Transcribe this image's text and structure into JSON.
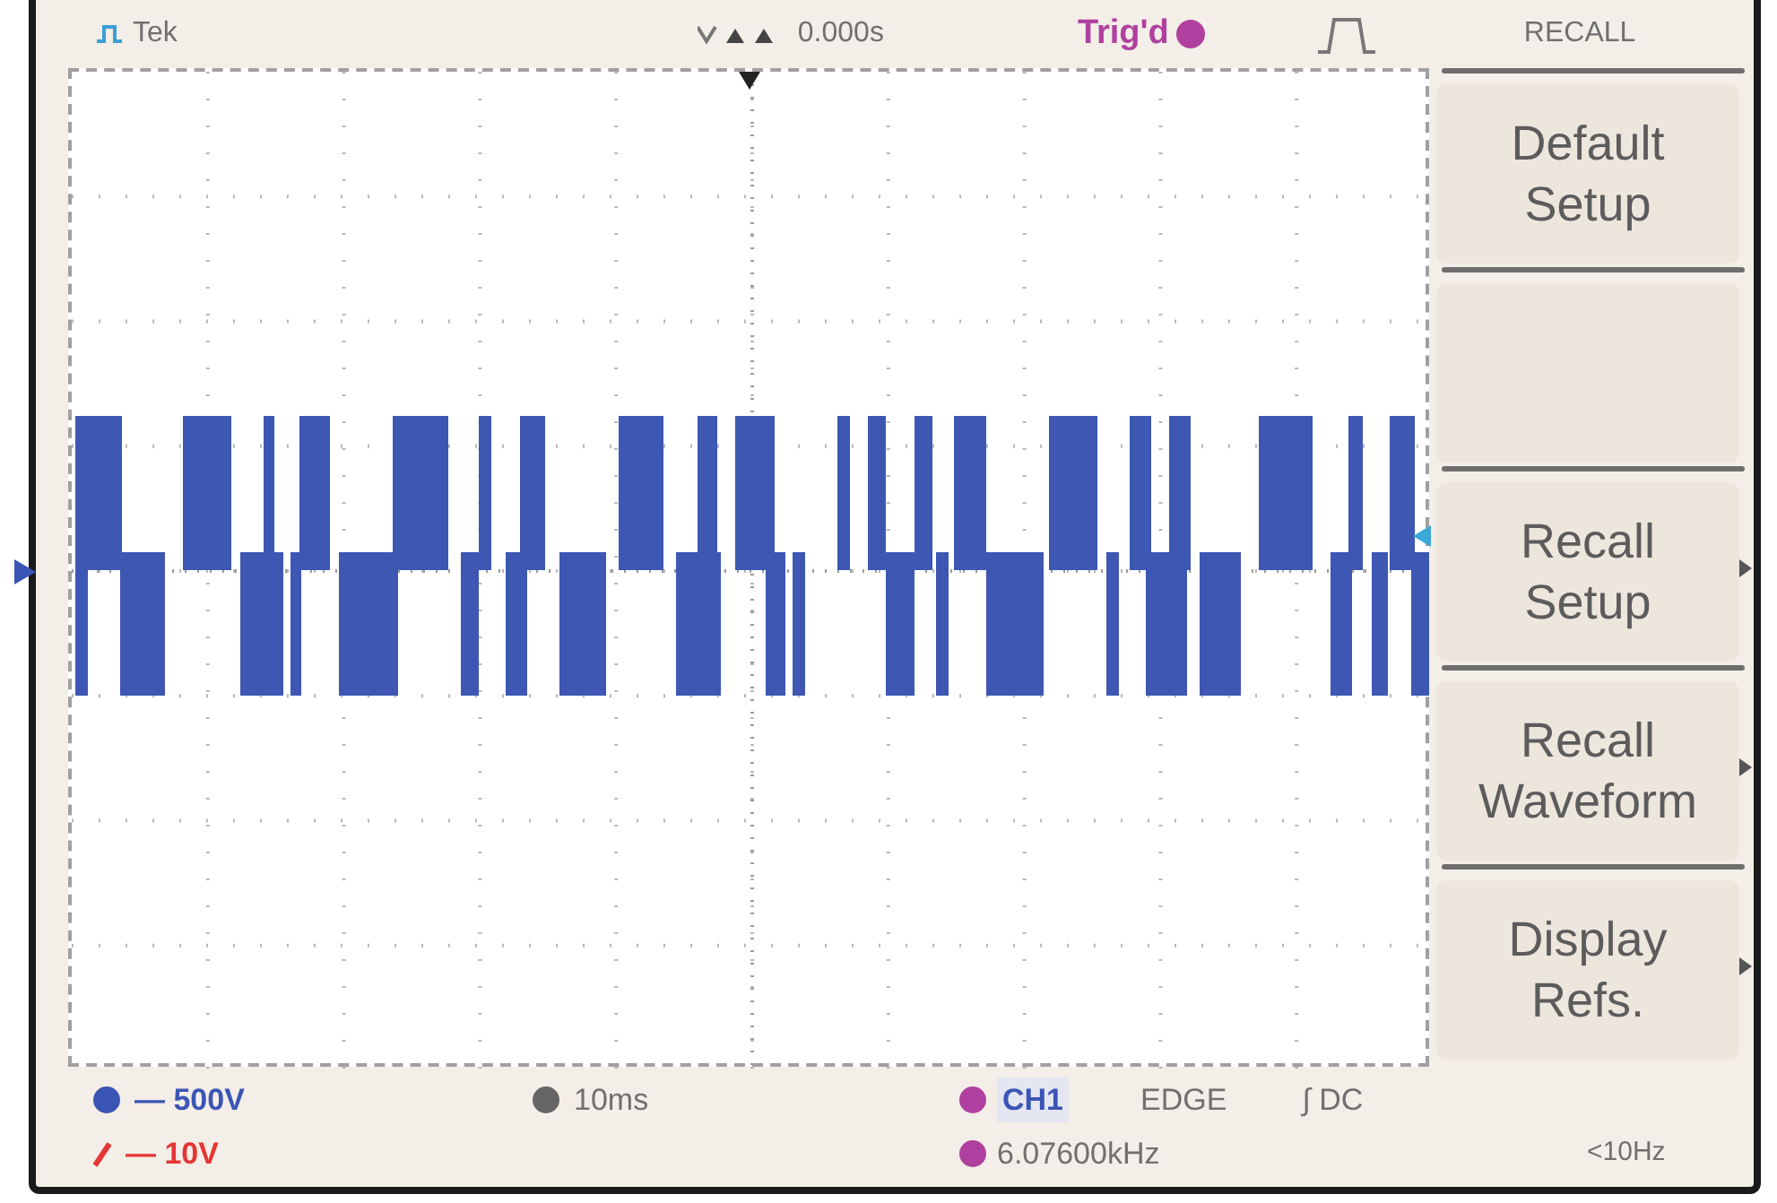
{
  "top_bar": {
    "brand": "Tek",
    "position": "0.000s",
    "trigger_status": "Trig'd",
    "menu_title": "RECALL"
  },
  "menu": {
    "items": [
      {
        "kind": "button",
        "label": "Default Setup",
        "submenu": false
      },
      {
        "kind": "blank",
        "submenu": false
      },
      {
        "kind": "button",
        "label": "Recall Setup",
        "submenu": true
      },
      {
        "kind": "button",
        "label": "Recall Waveform",
        "submenu": true
      },
      {
        "kind": "button",
        "label": "Display Refs.",
        "submenu": true
      }
    ]
  },
  "readouts": {
    "channels": [
      {
        "scale": "— 500V",
        "color": "#3b55b5"
      },
      {
        "scale": "— 10V",
        "color": "#e53535"
      }
    ],
    "timebase": "10ms",
    "trigger": {
      "source": "CH1",
      "type": "EDGE",
      "coupling": "∫ DC",
      "frequency": "6.07600kHz"
    },
    "frequency_limit": "<10Hz"
  }
}
